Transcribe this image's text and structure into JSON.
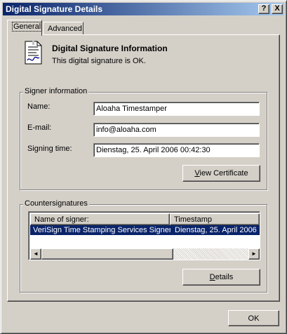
{
  "window": {
    "title": "Digital Signature Details",
    "help_glyph": "?",
    "close_glyph": "X"
  },
  "tabs": [
    {
      "label": "General",
      "selected": true
    },
    {
      "label": "Advanced",
      "selected": false
    }
  ],
  "info": {
    "title": "Digital Signature Information",
    "status": "This digital signature is OK."
  },
  "signer": {
    "group_label": "Signer information",
    "name_label": "Name:",
    "name_value": "Aloaha Timestamper",
    "email_label": "E-mail:",
    "email_value": "info@aloaha.com",
    "time_label": "Signing time:",
    "time_value": "Dienstag, 25. April 2006 00:42:30",
    "view_cert_mnemonic": "V",
    "view_cert_rest": "iew Certificate"
  },
  "countersignatures": {
    "group_label": "Countersignatures",
    "columns": [
      "Name of signer:",
      "Timestamp"
    ],
    "rows": [
      [
        "VeriSign Time Stamping Services Signer",
        "Dienstag, 25. April 2006"
      ]
    ],
    "details_mnemonic": "D",
    "details_rest": "etails"
  },
  "footer": {
    "ok_label": "OK"
  },
  "icons": {
    "certificate": "certificate-icon",
    "scroll_left": "◄",
    "scroll_right": "►"
  }
}
